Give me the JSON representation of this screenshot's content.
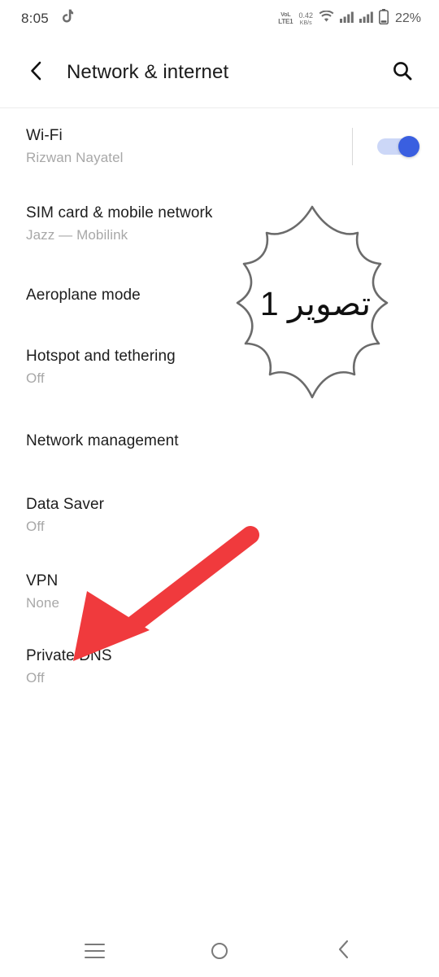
{
  "status_bar": {
    "time": "8:05",
    "notification_icon": "tiktok-icon",
    "volte_top": "VoL",
    "volte_bottom": "LTE1",
    "net_speed_value": "0.42",
    "net_speed_unit": "KB/s",
    "wifi_icon": "wifi-icon",
    "signal_icon_1": "signal-bars-icon",
    "signal_icon_2": "signal-bars-icon",
    "battery_icon": "battery-icon",
    "battery_percent": "22%"
  },
  "header": {
    "back_icon": "back-chevron-icon",
    "title": "Network & internet",
    "search_icon": "search-icon"
  },
  "list": {
    "rows": [
      {
        "title": "Wi-Fi",
        "subtitle": "Rizwan Nayatel",
        "has_toggle": true,
        "toggle_on": true
      },
      {
        "title": "SIM card & mobile network",
        "subtitle": "Jazz — Mobilink",
        "has_toggle": false
      },
      {
        "title": "Aeroplane mode",
        "subtitle": "",
        "has_toggle": false
      },
      {
        "title": "Hotspot and tethering",
        "subtitle": "Off",
        "has_toggle": false
      },
      {
        "title": "Network management",
        "subtitle": "",
        "has_toggle": false
      },
      {
        "title": "Data Saver",
        "subtitle": "Off",
        "has_toggle": false
      },
      {
        "title": "VPN",
        "subtitle": "None",
        "has_toggle": false
      },
      {
        "title": "Private DNS",
        "subtitle": "Off",
        "has_toggle": false
      }
    ]
  },
  "annotations": {
    "callout_text": "تصوير 1",
    "callout_stroke_color": "#6b6b6b",
    "arrow_color": "#f03a3d",
    "arrow_points_to": "Private DNS"
  },
  "nav_bar": {
    "recents_icon": "menu-icon",
    "home_icon": "circle-home-icon",
    "back_icon": "back-chevron-icon"
  },
  "colors": {
    "accent_toggle": "#3a5fe0",
    "toggle_track": "#ccd7f7",
    "title_text": "#1d1d1d",
    "subtitle_text": "#a8a8a8",
    "background": "#ffffff"
  }
}
